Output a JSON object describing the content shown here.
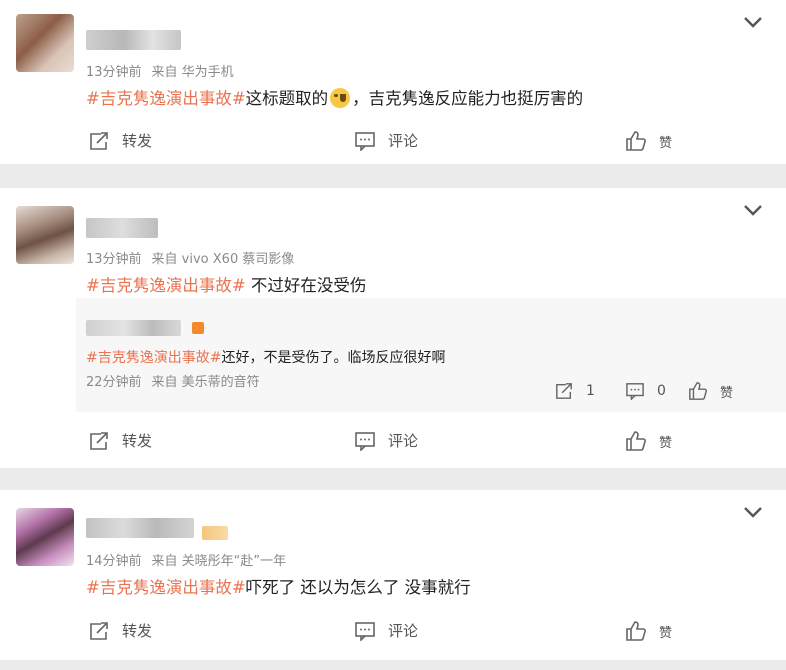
{
  "comments": [
    {
      "meta_time": "13分钟前",
      "meta_source": "来自 华为手机",
      "hashtag": "#吉克隽逸演出事故#",
      "text_a": "这标题取的",
      "text_b": "，吉克隽逸反应能力也挺厉害的",
      "emoji_icon": "laughing-tears-emoji"
    },
    {
      "meta_time": "13分钟前",
      "meta_source": "来自 vivo X60 蔡司影像",
      "hashtag": "#吉克隽逸演出事故#",
      "text_a": " 不过好在没受伤"
    },
    {
      "meta_time": "14分钟前",
      "meta_source": "来自 关晓彤年“赴”一年",
      "hashtag": "#吉克隽逸演出事故#",
      "text_a": "吓死了 还以为怎么了 没事就行"
    }
  ],
  "reply": {
    "hashtag": "#吉克隽逸演出事故#",
    "text": "还好，不是受伤了。临场反应很好啊",
    "meta_time": "22分钟前",
    "meta_source": "来自 美乐蒂的音符",
    "repost_count": "1",
    "comment_count": "0",
    "like_label": "赞"
  },
  "actions": {
    "repost": "转发",
    "comment": "评论",
    "like": "赞"
  },
  "colors": {
    "hashtag": "#eb7350",
    "meta": "#8a8a8a",
    "background": "#ececec"
  }
}
